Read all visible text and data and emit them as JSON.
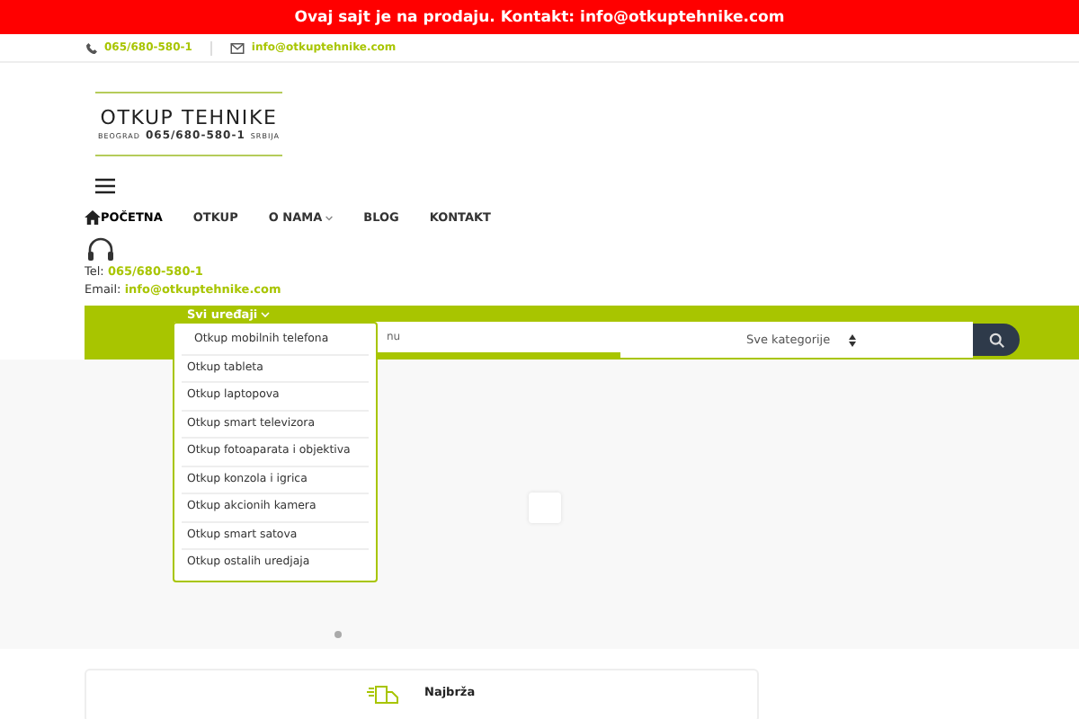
{
  "announcement": "Ovaj sajt je na prodaju. Kontakt: info@otkuptehnike.com",
  "topbar": {
    "phone": "065/680-580-1",
    "email": "info@otkuptehnike.com"
  },
  "logo": {
    "title": "OTKUP TEHNIKE",
    "city": "BEOGRAD",
    "phone": "065/680-580-1",
    "country": "SRBIJA"
  },
  "nav": [
    {
      "label": "POČETNA",
      "selected": true,
      "kind": "home"
    },
    {
      "label": "OTKUP",
      "selected": false,
      "kind": "plain"
    },
    {
      "label": "O NAMA",
      "selected": false,
      "kind": "dropdown"
    },
    {
      "label": "BLOG",
      "selected": false,
      "kind": "plain"
    },
    {
      "label": "KONTAKT",
      "selected": false,
      "kind": "plain"
    }
  ],
  "contact": {
    "tel_label": "Tel:",
    "tel": "065/680-580-1",
    "email_label": "Email:",
    "email": "info@otkuptehnike.com"
  },
  "categories": {
    "label": "Svi uređaji",
    "expanded": true,
    "items": [
      "Otkup mobilnih telefona",
      "Otkup tableta",
      "Otkup laptopova",
      "Otkup smart televizora",
      "Otkup fotoaparata i objektiva",
      "Otkup konzola i igrica",
      "Otkup akcionih kamera",
      "Otkup smart satova",
      "Otkup ostalih uredjaja"
    ]
  },
  "search": {
    "placeholder": "nu",
    "category": "Sve kategorije"
  },
  "slider": {
    "dots": [
      {
        "selected": true
      }
    ]
  },
  "feature": {
    "title": "Najbrža"
  }
}
